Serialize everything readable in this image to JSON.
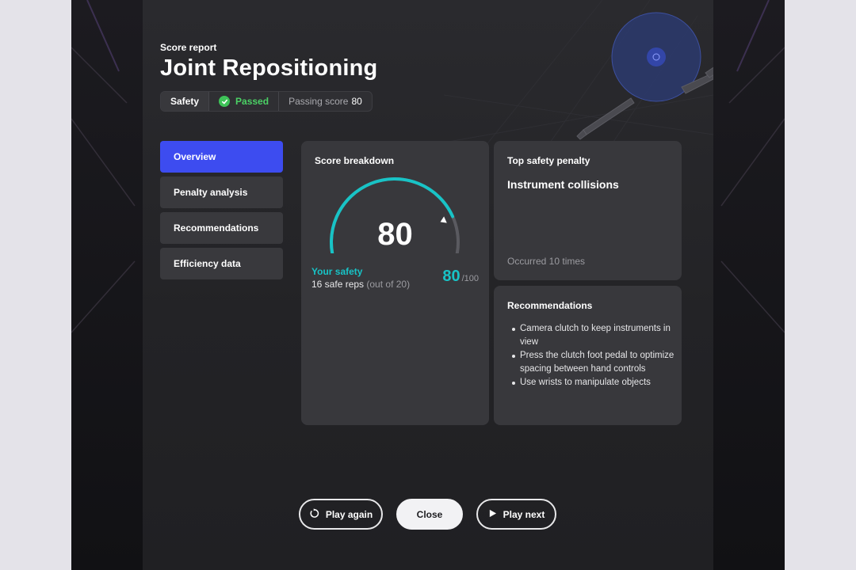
{
  "header": {
    "subtitle": "Score report",
    "title": "Joint Repositioning"
  },
  "status": {
    "category": "Safety",
    "result": "Passed",
    "passing_label": "Passing score",
    "passing_score": "80"
  },
  "nav": {
    "items": [
      {
        "label": "Overview",
        "active": true
      },
      {
        "label": "Penalty analysis",
        "active": false
      },
      {
        "label": "Recommendations",
        "active": false
      },
      {
        "label": "Efficiency data",
        "active": false
      }
    ]
  },
  "score_card": {
    "title": "Score breakdown",
    "score": "80",
    "score_fraction": 0.8,
    "your_label": "Your safety",
    "reps_text": "16 safe reps",
    "reps_out_of": "(out of 20)",
    "score_value": "80",
    "score_max": "/100"
  },
  "penalty_card": {
    "title": "Top safety penalty",
    "name": "Instrument collisions",
    "occurrence": "Occurred 10 times"
  },
  "recs_card": {
    "title": "Recommendations",
    "items": [
      "Camera clutch to keep instruments in view",
      "Press the clutch foot pedal to optimize spacing between hand controls",
      "Use wrists to manipulate objects"
    ]
  },
  "buttons": {
    "play_again": "Play again",
    "close": "Close",
    "play_next": "Play next"
  },
  "colors": {
    "accent_blue": "#3d4cf0",
    "teal": "#18c3c6",
    "pass_green": "#4bd165"
  }
}
